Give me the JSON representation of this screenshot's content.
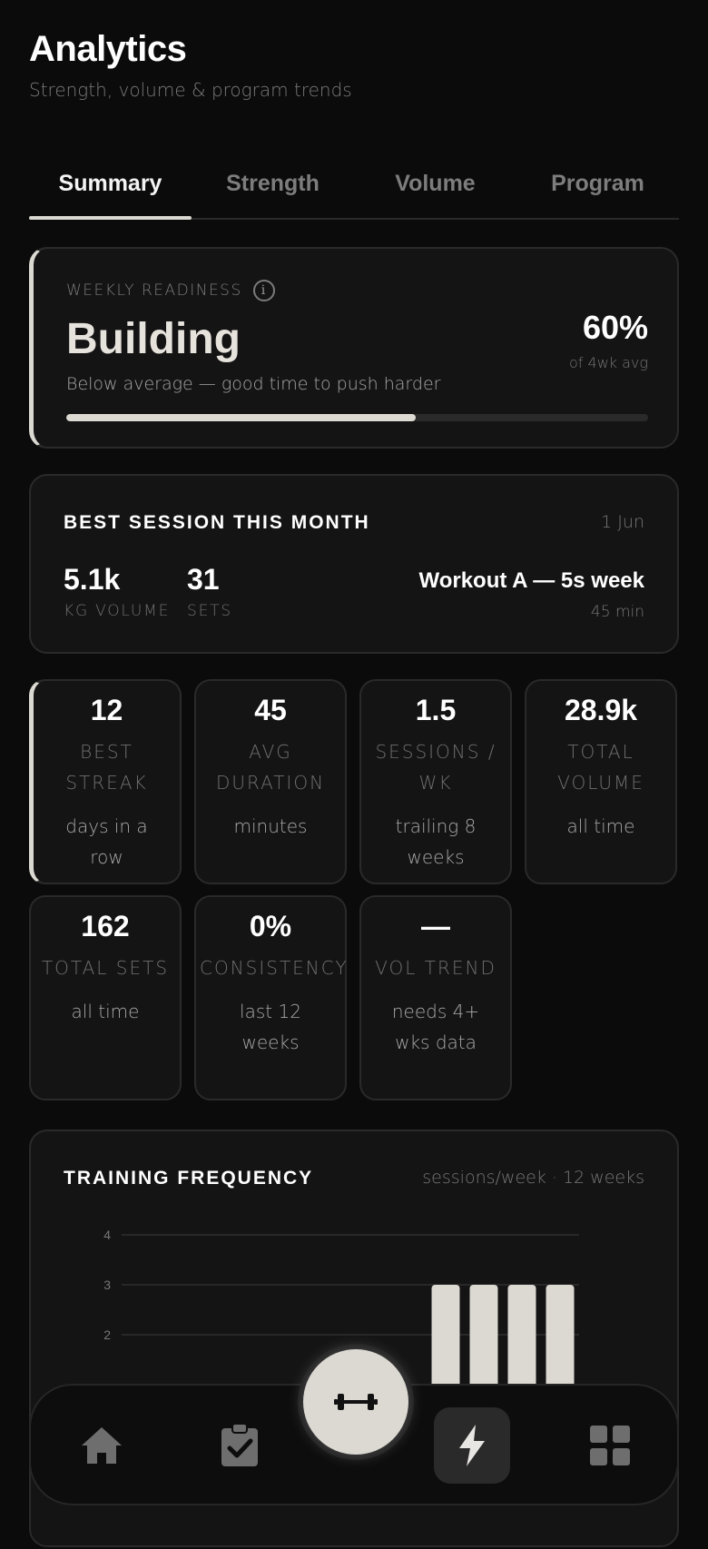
{
  "header": {
    "title": "Analytics",
    "subtitle": "Strength, volume & program trends"
  },
  "tabs": [
    {
      "label": "Summary",
      "active": true
    },
    {
      "label": "Strength",
      "active": false
    },
    {
      "label": "Volume",
      "active": false
    },
    {
      "label": "Program",
      "active": false
    }
  ],
  "readiness": {
    "label": "WEEKLY READINESS",
    "info_icon": "i",
    "status": "Building",
    "description": "Below average — good time to push harder",
    "percent": "60%",
    "percent_sub": "of 4wk avg",
    "progress": 0.6
  },
  "best_session": {
    "heading": "BEST SESSION THIS MONTH",
    "date": "1 Jun",
    "volume_value": "5.1k",
    "volume_label": "KG VOLUME",
    "sets_value": "31",
    "sets_label": "SETS",
    "workout_name": "Workout A — 5s week",
    "duration": "45 min"
  },
  "stats": [
    {
      "value": "12",
      "label": "BEST STREAK",
      "sub": "days in a row"
    },
    {
      "value": "45",
      "label": "AVG DURATION",
      "sub": "minutes"
    },
    {
      "value": "1.5",
      "label": "SESSIONS / WK",
      "sub": "trailing 8 weeks"
    },
    {
      "value": "28.9k",
      "label": "TOTAL VOLUME",
      "sub": "all time"
    },
    {
      "value": "162",
      "label": "TOTAL SETS",
      "sub": "all time"
    },
    {
      "value": "0%",
      "label": "CONSISTENCY",
      "sub": "last 12 weeks"
    },
    {
      "value": "—",
      "label": "VOL TREND",
      "sub": "needs 4+ wks data"
    }
  ],
  "frequency": {
    "heading": "TRAINING FREQUENCY",
    "subtitle": "sessions/week · 12 weeks"
  },
  "chart_data": {
    "type": "bar",
    "title": "TRAINING FREQUENCY",
    "subtitle": "sessions/week · 12 weeks",
    "y_ticks": [
      4,
      3,
      2
    ],
    "ylim": [
      0,
      4
    ],
    "values": [
      0,
      0,
      0,
      0,
      0,
      0,
      0,
      0,
      3,
      3,
      3,
      3
    ],
    "grid": true,
    "bar_color": "#dcd8d2"
  },
  "nav": {
    "items": [
      "home-icon",
      "clipboard-check-icon",
      "dumbbell-icon",
      "bolt-icon",
      "grid-icon"
    ]
  },
  "colors": {
    "background": "#0b0b0b",
    "card": "#141414",
    "accent": "#dcd8d2",
    "muted": "#777777"
  }
}
